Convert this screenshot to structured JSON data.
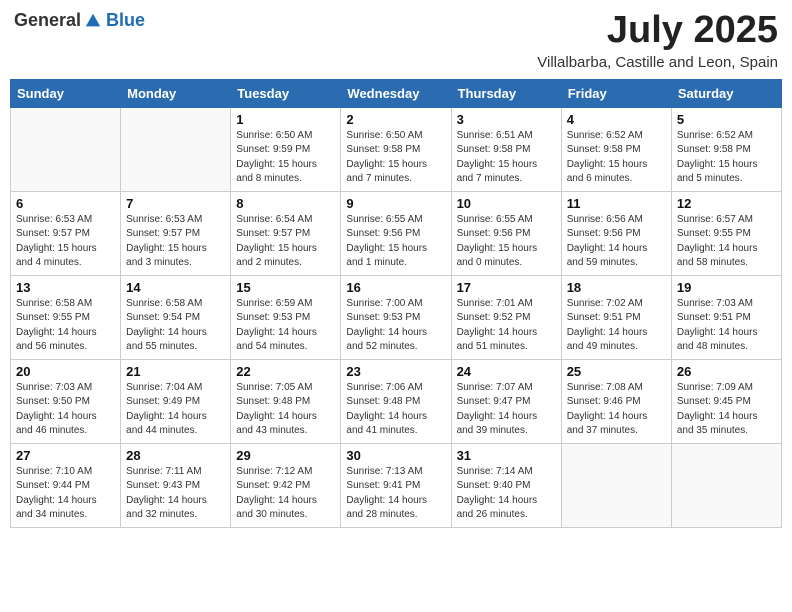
{
  "header": {
    "logo_general": "General",
    "logo_blue": "Blue",
    "month_title": "July 2025",
    "location": "Villalbarba, Castille and Leon, Spain"
  },
  "weekdays": [
    "Sunday",
    "Monday",
    "Tuesday",
    "Wednesday",
    "Thursday",
    "Friday",
    "Saturday"
  ],
  "weeks": [
    [
      {
        "day": "",
        "info": ""
      },
      {
        "day": "",
        "info": ""
      },
      {
        "day": "1",
        "info": "Sunrise: 6:50 AM\nSunset: 9:59 PM\nDaylight: 15 hours\nand 8 minutes."
      },
      {
        "day": "2",
        "info": "Sunrise: 6:50 AM\nSunset: 9:58 PM\nDaylight: 15 hours\nand 7 minutes."
      },
      {
        "day": "3",
        "info": "Sunrise: 6:51 AM\nSunset: 9:58 PM\nDaylight: 15 hours\nand 7 minutes."
      },
      {
        "day": "4",
        "info": "Sunrise: 6:52 AM\nSunset: 9:58 PM\nDaylight: 15 hours\nand 6 minutes."
      },
      {
        "day": "5",
        "info": "Sunrise: 6:52 AM\nSunset: 9:58 PM\nDaylight: 15 hours\nand 5 minutes."
      }
    ],
    [
      {
        "day": "6",
        "info": "Sunrise: 6:53 AM\nSunset: 9:57 PM\nDaylight: 15 hours\nand 4 minutes."
      },
      {
        "day": "7",
        "info": "Sunrise: 6:53 AM\nSunset: 9:57 PM\nDaylight: 15 hours\nand 3 minutes."
      },
      {
        "day": "8",
        "info": "Sunrise: 6:54 AM\nSunset: 9:57 PM\nDaylight: 15 hours\nand 2 minutes."
      },
      {
        "day": "9",
        "info": "Sunrise: 6:55 AM\nSunset: 9:56 PM\nDaylight: 15 hours\nand 1 minute."
      },
      {
        "day": "10",
        "info": "Sunrise: 6:55 AM\nSunset: 9:56 PM\nDaylight: 15 hours\nand 0 minutes."
      },
      {
        "day": "11",
        "info": "Sunrise: 6:56 AM\nSunset: 9:56 PM\nDaylight: 14 hours\nand 59 minutes."
      },
      {
        "day": "12",
        "info": "Sunrise: 6:57 AM\nSunset: 9:55 PM\nDaylight: 14 hours\nand 58 minutes."
      }
    ],
    [
      {
        "day": "13",
        "info": "Sunrise: 6:58 AM\nSunset: 9:55 PM\nDaylight: 14 hours\nand 56 minutes."
      },
      {
        "day": "14",
        "info": "Sunrise: 6:58 AM\nSunset: 9:54 PM\nDaylight: 14 hours\nand 55 minutes."
      },
      {
        "day": "15",
        "info": "Sunrise: 6:59 AM\nSunset: 9:53 PM\nDaylight: 14 hours\nand 54 minutes."
      },
      {
        "day": "16",
        "info": "Sunrise: 7:00 AM\nSunset: 9:53 PM\nDaylight: 14 hours\nand 52 minutes."
      },
      {
        "day": "17",
        "info": "Sunrise: 7:01 AM\nSunset: 9:52 PM\nDaylight: 14 hours\nand 51 minutes."
      },
      {
        "day": "18",
        "info": "Sunrise: 7:02 AM\nSunset: 9:51 PM\nDaylight: 14 hours\nand 49 minutes."
      },
      {
        "day": "19",
        "info": "Sunrise: 7:03 AM\nSunset: 9:51 PM\nDaylight: 14 hours\nand 48 minutes."
      }
    ],
    [
      {
        "day": "20",
        "info": "Sunrise: 7:03 AM\nSunset: 9:50 PM\nDaylight: 14 hours\nand 46 minutes."
      },
      {
        "day": "21",
        "info": "Sunrise: 7:04 AM\nSunset: 9:49 PM\nDaylight: 14 hours\nand 44 minutes."
      },
      {
        "day": "22",
        "info": "Sunrise: 7:05 AM\nSunset: 9:48 PM\nDaylight: 14 hours\nand 43 minutes."
      },
      {
        "day": "23",
        "info": "Sunrise: 7:06 AM\nSunset: 9:48 PM\nDaylight: 14 hours\nand 41 minutes."
      },
      {
        "day": "24",
        "info": "Sunrise: 7:07 AM\nSunset: 9:47 PM\nDaylight: 14 hours\nand 39 minutes."
      },
      {
        "day": "25",
        "info": "Sunrise: 7:08 AM\nSunset: 9:46 PM\nDaylight: 14 hours\nand 37 minutes."
      },
      {
        "day": "26",
        "info": "Sunrise: 7:09 AM\nSunset: 9:45 PM\nDaylight: 14 hours\nand 35 minutes."
      }
    ],
    [
      {
        "day": "27",
        "info": "Sunrise: 7:10 AM\nSunset: 9:44 PM\nDaylight: 14 hours\nand 34 minutes."
      },
      {
        "day": "28",
        "info": "Sunrise: 7:11 AM\nSunset: 9:43 PM\nDaylight: 14 hours\nand 32 minutes."
      },
      {
        "day": "29",
        "info": "Sunrise: 7:12 AM\nSunset: 9:42 PM\nDaylight: 14 hours\nand 30 minutes."
      },
      {
        "day": "30",
        "info": "Sunrise: 7:13 AM\nSunset: 9:41 PM\nDaylight: 14 hours\nand 28 minutes."
      },
      {
        "day": "31",
        "info": "Sunrise: 7:14 AM\nSunset: 9:40 PM\nDaylight: 14 hours\nand 26 minutes."
      },
      {
        "day": "",
        "info": ""
      },
      {
        "day": "",
        "info": ""
      }
    ]
  ]
}
